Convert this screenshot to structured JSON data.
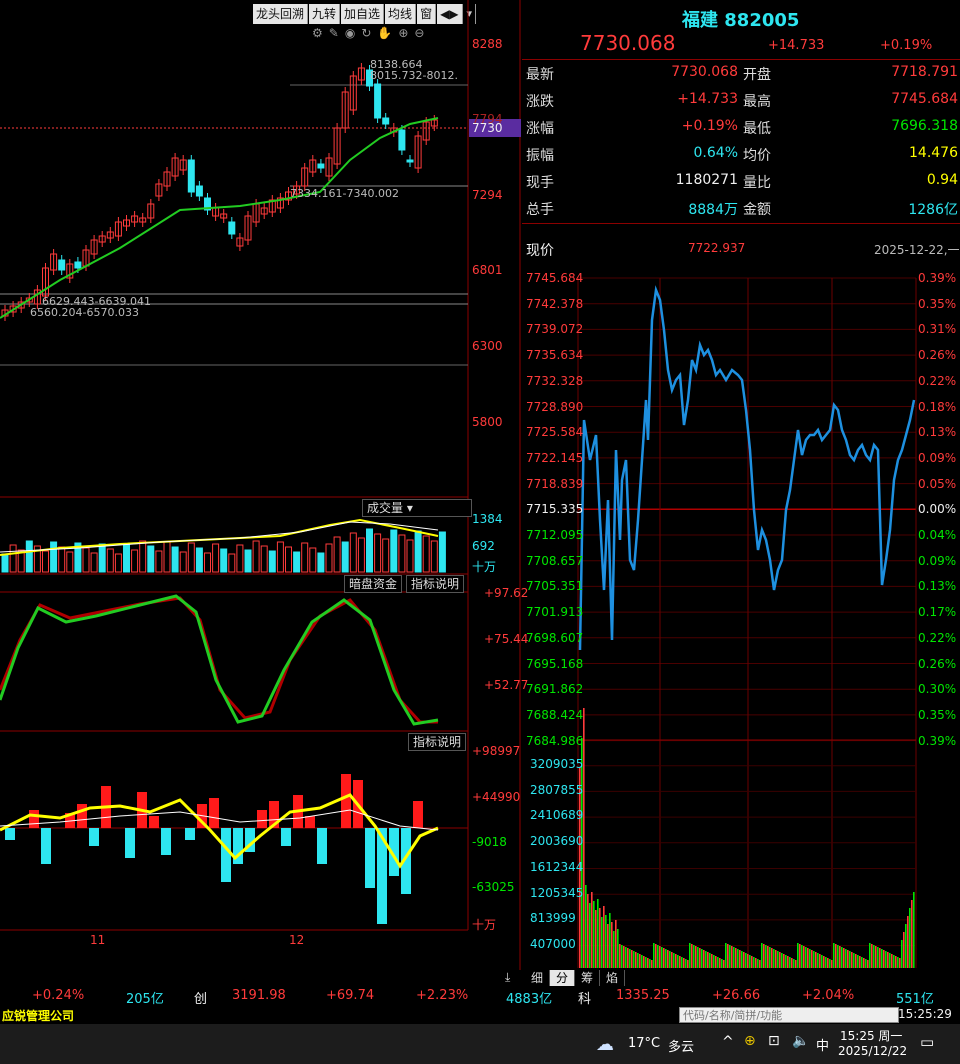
{
  "toolbar": {
    "btn1": "龙头回溯",
    "btn2": "九转",
    "btn3": "加自选",
    "btn4": "均线",
    "btn5": "窗",
    "btn6": "◀▶",
    "btn7": "▾"
  },
  "kline": {
    "yticks": [
      "8288",
      "7794",
      "7294",
      "6801",
      "6300",
      "5800"
    ],
    "current_price_tag": "7730",
    "annotations": {
      "high": "8138.664",
      "high_range": "8015.732-8012.",
      "mid_range": "7334.161-7340.002",
      "gap_upper": "6629.443-6639.041",
      "gap_lower": "6560.204-6570.033"
    },
    "x_labels": [
      "11",
      "12"
    ]
  },
  "volume": {
    "label": "成交量",
    "yticks": [
      "1384",
      "692",
      "十万"
    ]
  },
  "indicator1": {
    "label": "暗盘资金",
    "help": "指标说明",
    "yticks": [
      "+97.62",
      "+75.44",
      "+52.77"
    ]
  },
  "indicator2": {
    "help": "指标说明",
    "yticks": [
      "+98997",
      "+44990",
      "-9018",
      "-63025",
      "十万"
    ]
  },
  "header": {
    "name": "福建",
    "code": "882005",
    "price": "7730.068",
    "change": "+14.733",
    "change_pct": "+0.19%"
  },
  "quote": {
    "rows": [
      {
        "l1": "最新",
        "v1": "7730.068",
        "l2": "开盘",
        "v2": "7718.791",
        "c1": "red",
        "c2": "red"
      },
      {
        "l1": "涨跌",
        "v1": "+14.733",
        "l2": "最高",
        "v2": "7745.684",
        "c1": "red",
        "c2": "red"
      },
      {
        "l1": "涨幅",
        "v1": "+0.19%",
        "l2": "最低",
        "v2": "7696.318",
        "c1": "red",
        "c2": "green"
      },
      {
        "l1": "振幅",
        "v1": "0.64%",
        "l2": "均价",
        "v2": "14.476",
        "c1": "cyan",
        "c2": "yellow"
      },
      {
        "l1": "现手",
        "v1": "1180271",
        "l2": "量比",
        "v2": "0.94",
        "c1": "white",
        "c2": "yellow"
      },
      {
        "l1": "总手",
        "v1": "8884万",
        "l2": "金额",
        "v2": "1286亿",
        "c1": "cyan",
        "c2": "cyan"
      }
    ]
  },
  "intraday": {
    "label": "现价",
    "price": "7722.937",
    "date": "2025-12-22,一",
    "left_ticks": [
      "7745.684",
      "7742.378",
      "7739.072",
      "7735.634",
      "7732.328",
      "7728.890",
      "7725.584",
      "7722.145",
      "7718.839",
      "7715.335",
      "7712.095",
      "7708.657",
      "7705.351",
      "7701.913",
      "7698.607",
      "7695.168",
      "7691.862",
      "7688.424",
      "7684.986"
    ],
    "right_ticks": [
      "0.39%",
      "0.35%",
      "0.31%",
      "0.26%",
      "0.22%",
      "0.18%",
      "0.13%",
      "0.09%",
      "0.05%",
      "0.00%",
      "0.04%",
      "0.09%",
      "0.13%",
      "0.17%",
      "0.22%",
      "0.26%",
      "0.30%",
      "0.35%",
      "0.39%"
    ],
    "vol_ticks": [
      "3209035",
      "2807855",
      "2410689",
      "2003690",
      "1612344",
      "1205345",
      "813999",
      "407000"
    ]
  },
  "tabs": [
    "细",
    "分",
    "筹",
    "焰"
  ],
  "bottom": {
    "t1": "+0.24%",
    "t2": "205亿",
    "t3": "创",
    "t4": "3191.98",
    "t5": "+69.74",
    "t6": "+2.23%",
    "t7": "4883亿",
    "t8": "科",
    "t9": "1335.25",
    "t10": "+26.66",
    "t11": "+2.04%",
    "t12": "551亿"
  },
  "statusbar": {
    "company": "应锐管理公司",
    "search_placeholder": "代码/名称/简拼/功能",
    "time": "15:25:29"
  },
  "taskbar": {
    "temp": "17°C",
    "weather": "多云",
    "ime": "中",
    "clock_time": "15:25 周一",
    "clock_date": "2025/12/22"
  },
  "colors": {
    "up": "#ff3b3b",
    "down": "#2ee6f0",
    "ma": "#22cc22",
    "intraday": "#1e90e0"
  }
}
